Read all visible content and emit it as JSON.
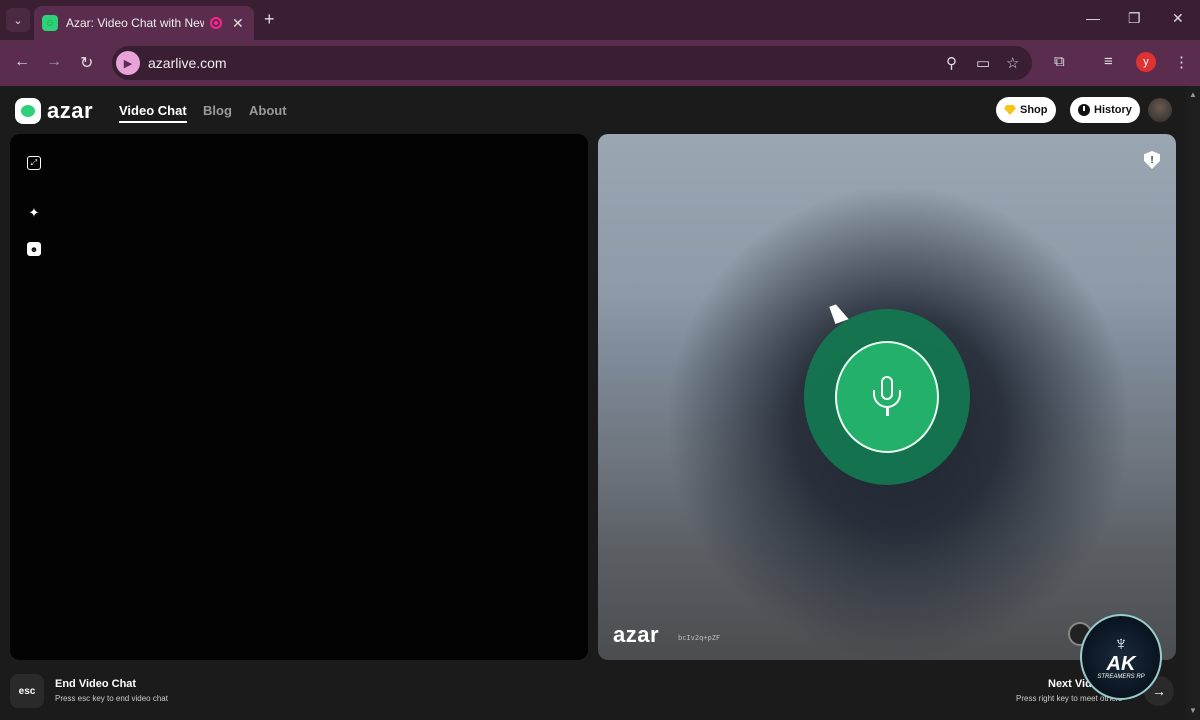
{
  "browser": {
    "tab_title": "Azar: Video Chat with New",
    "tab_close": "✕",
    "new_tab": "+",
    "url": "azarlive.com",
    "profile_initial": "y",
    "window_controls": {
      "minimize": "—",
      "restore": "❐",
      "close": "✕"
    }
  },
  "header": {
    "logo_text": "azar",
    "nav": [
      {
        "label": "Video Chat",
        "active": true
      },
      {
        "label": "Blog",
        "active": false
      },
      {
        "label": "About",
        "active": false
      }
    ],
    "shop_label": "Shop",
    "history_label": "History"
  },
  "video": {
    "watermark_logo": "azar",
    "watermark_id": "bcIv2q+pZF"
  },
  "footer": {
    "esc_key": "esc",
    "end_title": "End Video Chat",
    "end_sub": "Press esc key to end video chat",
    "next_title": "Next Vid",
    "next_sub": "Press right key to meet others",
    "next_arrow": "→"
  },
  "overlay_badge": {
    "title": "AK",
    "subtitle": "STREAMERS RP"
  },
  "colors": {
    "brand_green": "#2fd07a",
    "mic_green": "#22b06a",
    "browser_frame": "#5a2d4f"
  },
  "icons": [
    "search-icon",
    "cast-icon",
    "star-icon",
    "extensions-icon",
    "media-icon",
    "menu-icon",
    "shield-icon",
    "mic-icon"
  ]
}
